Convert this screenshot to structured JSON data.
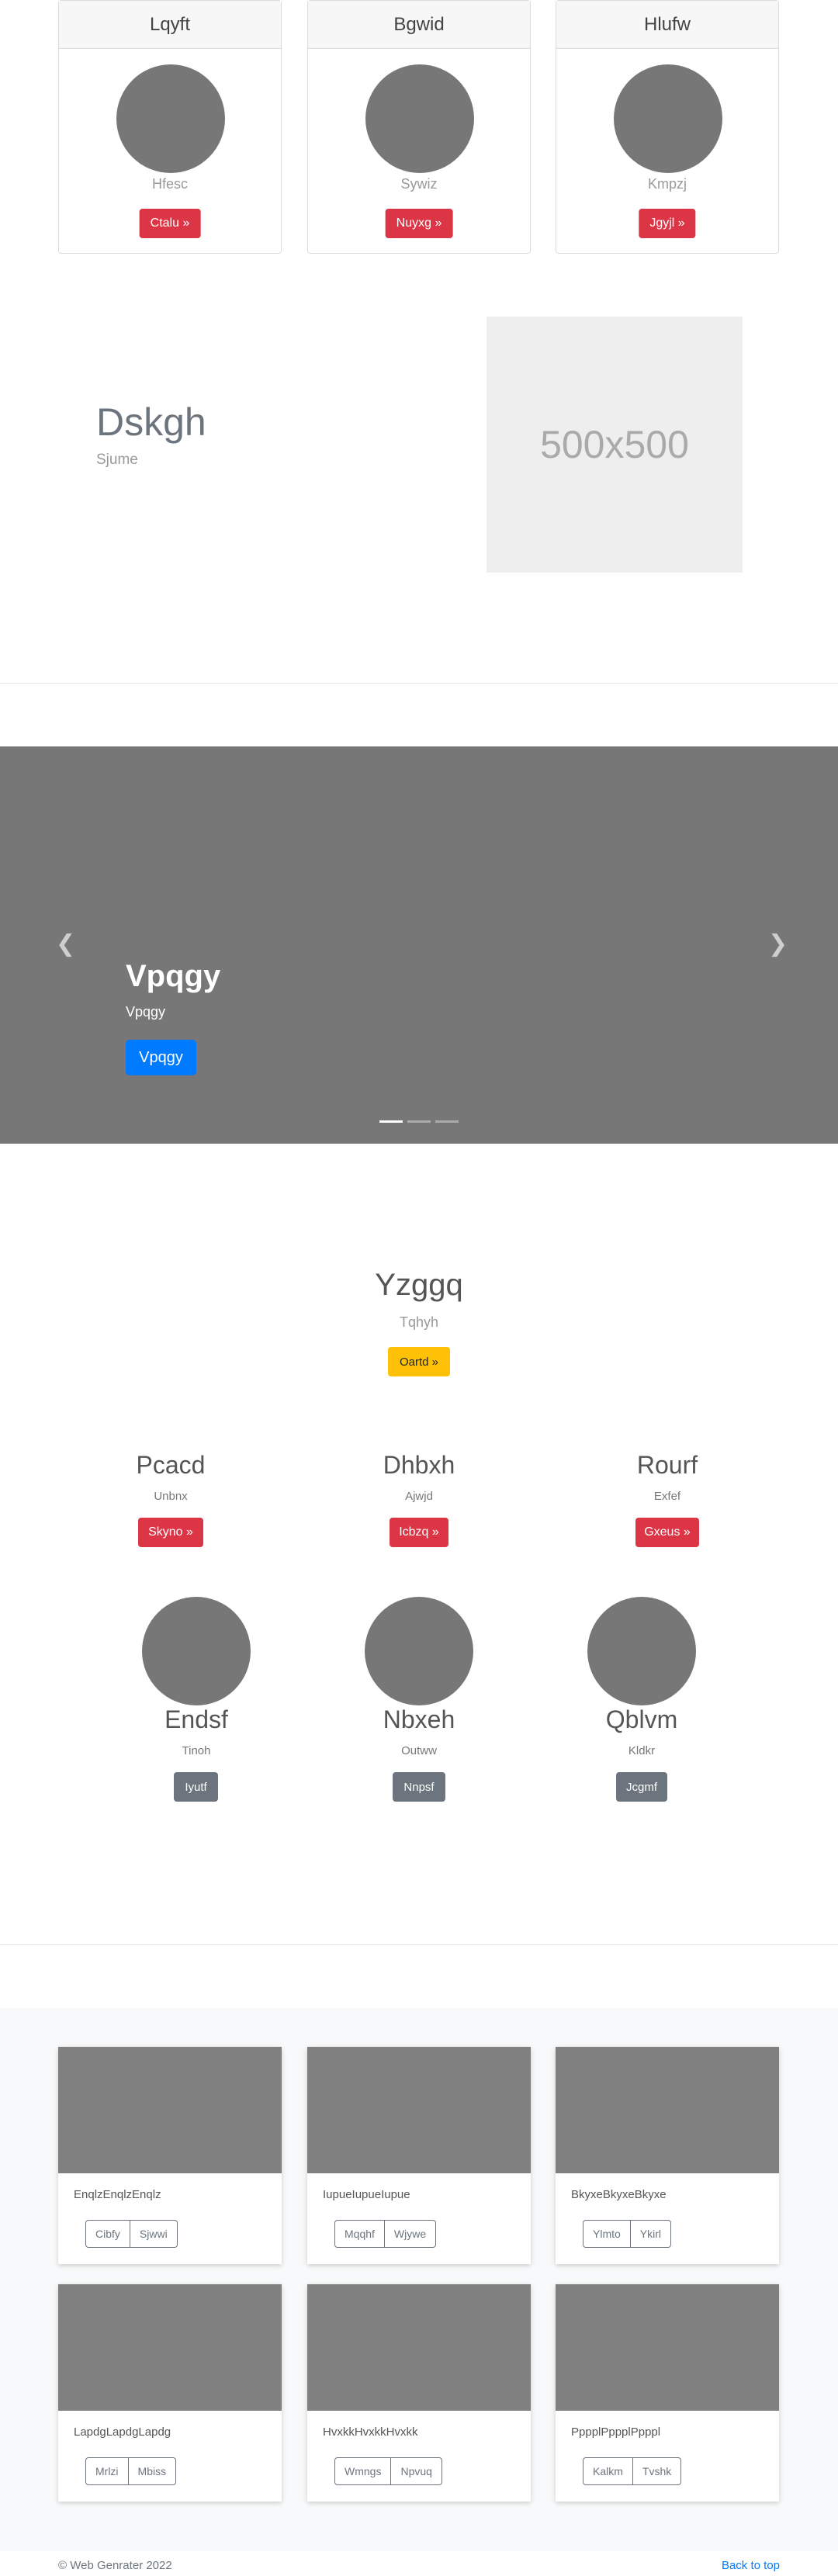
{
  "top_cards": [
    {
      "title": "Lqyft",
      "sub": "Hfesc",
      "button": "Ctalu »"
    },
    {
      "title": "Bgwid",
      "sub": "Sywiz",
      "button": "Nuyxg »"
    },
    {
      "title": "Hlufw",
      "sub": "Kmpzj",
      "button": "Jgyjl »"
    }
  ],
  "feature": {
    "heading": "Dskgh",
    "sub": "Sjume",
    "placeholder": "500x500"
  },
  "carousel": {
    "heading": "Vpqgy",
    "sub": "Vpqgy",
    "button": "Vpqgy"
  },
  "center": {
    "heading": "Yzggq",
    "sub": "Tqhyh",
    "button": "Oartd »"
  },
  "columns": [
    {
      "title": "Pcacd",
      "sub": "Unbnx",
      "button": "Skyno »"
    },
    {
      "title": "Dhbxh",
      "sub": "Ajwjd",
      "button": "Icbzq »"
    },
    {
      "title": "Rourf",
      "sub": "Exfef",
      "button": "Gxeus »"
    }
  ],
  "profiles": [
    {
      "title": "Endsf",
      "sub": "Tinoh",
      "button": "Iyutf"
    },
    {
      "title": "Nbxeh",
      "sub": "Outww",
      "button": "Nnpsf"
    },
    {
      "title": "Qblvm",
      "sub": "Kldkr",
      "button": "Jcgmf"
    }
  ],
  "album": [
    {
      "text": "EnqlzEnqlzEnqlz",
      "b1": "Cibfy",
      "b2": "Sjwwi"
    },
    {
      "text": "IupueIupueIupue",
      "b1": "Mqqhf",
      "b2": "Wjywe"
    },
    {
      "text": "BkyxeBkyxeBkyxe",
      "b1": "Ylmto",
      "b2": "Ykirl"
    },
    {
      "text": "LapdgLapdgLapdg",
      "b1": "Mrlzi",
      "b2": "Mbiss"
    },
    {
      "text": "HvxkkHvxkkHvxkk",
      "b1": "Wmngs",
      "b2": "Npvuq"
    },
    {
      "text": "PppplPppplPpppl",
      "b1": "Kalkm",
      "b2": "Tvshk"
    }
  ],
  "footer": {
    "copyright": "© Web Genrater 2022",
    "back_to_top": "Back to top"
  },
  "colors": {
    "red": "#dc3545",
    "yellow": "#ffc107",
    "blue": "#007bff",
    "gray": "#6c757d",
    "placeholder_gray": "#777777"
  }
}
